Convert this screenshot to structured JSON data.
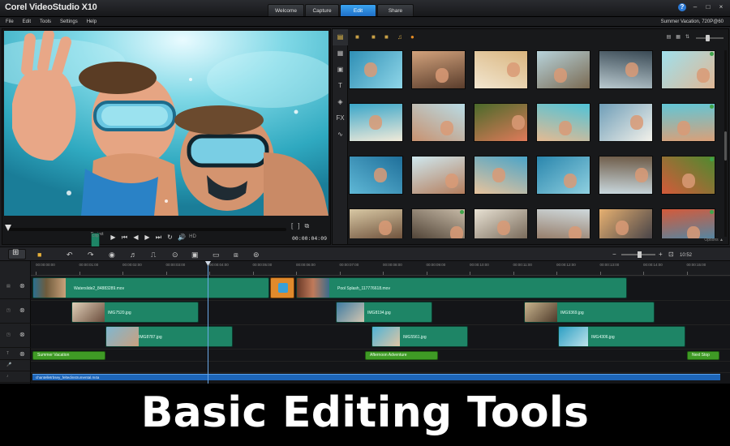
{
  "window": {
    "app_title": "Corel VideoStudio X10",
    "project_title": "Summer Vacation, 720P@60",
    "controls": [
      "?",
      "–",
      "□",
      "×"
    ]
  },
  "tabs": [
    {
      "label": "Welcome",
      "active": false
    },
    {
      "label": "Capture",
      "active": false
    },
    {
      "label": "Edit",
      "active": true
    },
    {
      "label": "Share",
      "active": false
    }
  ],
  "menu": [
    "File",
    "Edit",
    "Tools",
    "Settings",
    "Help"
  ],
  "player": {
    "mode_project": "Project",
    "mode_clip": "Clip",
    "timecode": "00:00:04:09",
    "quality": "HD",
    "transport_icons": [
      "play-icon",
      "go-start-icon",
      "prev-frame-icon",
      "next-frame-icon",
      "go-end-icon",
      "repeat-icon",
      "volume-icon"
    ],
    "transport_glyphs": [
      "▶",
      "⏮",
      "◀",
      "▶",
      "⏭",
      "↻",
      "🔊"
    ],
    "trim_glyphs": [
      "[",
      "]",
      "⧉"
    ]
  },
  "library": {
    "side_icons": [
      "media-icon",
      "instant-project-icon",
      "transition-icon",
      "title-icon",
      "graphic-icon",
      "filter-icon",
      "path-icon"
    ],
    "side_glyphs": [
      "▤",
      "▦",
      "▣",
      "T",
      "◈",
      "FX",
      "∿"
    ],
    "options_label": "Options ▲",
    "thumbnail_count": 24
  },
  "timeline": {
    "ruler": [
      "00:00:00:00",
      "00:00:01:00",
      "00:00:02:00",
      "00:00:03:00",
      "00:00:04:00",
      "00:00:05:00",
      "00:00:06:00",
      "00:00:07:00",
      "00:00:08:00",
      "00:00:09:00",
      "00:00:10:00",
      "00:00:11:00",
      "00:00:12:00",
      "00:00:13:00",
      "00:00:14:00",
      "00:00:15:00"
    ],
    "video_track": [
      "Waterslide2_84883289.mov",
      "Pool Splash_117776618.mov"
    ],
    "overlay_track_1": [
      "IMG7520.jpg",
      "IMG8194.jpg",
      "IMG9369.jpg"
    ],
    "overlay_track_2": [
      "IMG8787.jpg",
      "IMG5561.jpg",
      "IMG4306.jpg"
    ],
    "title_track": [
      "Summer Vacation",
      "Afternoon Adventure",
      "Next Stop"
    ],
    "music_track": "chantelletrbsey_feltedinstrumental.m4a",
    "zoom_label": "10:52"
  },
  "caption": "Basic Editing Tools"
}
